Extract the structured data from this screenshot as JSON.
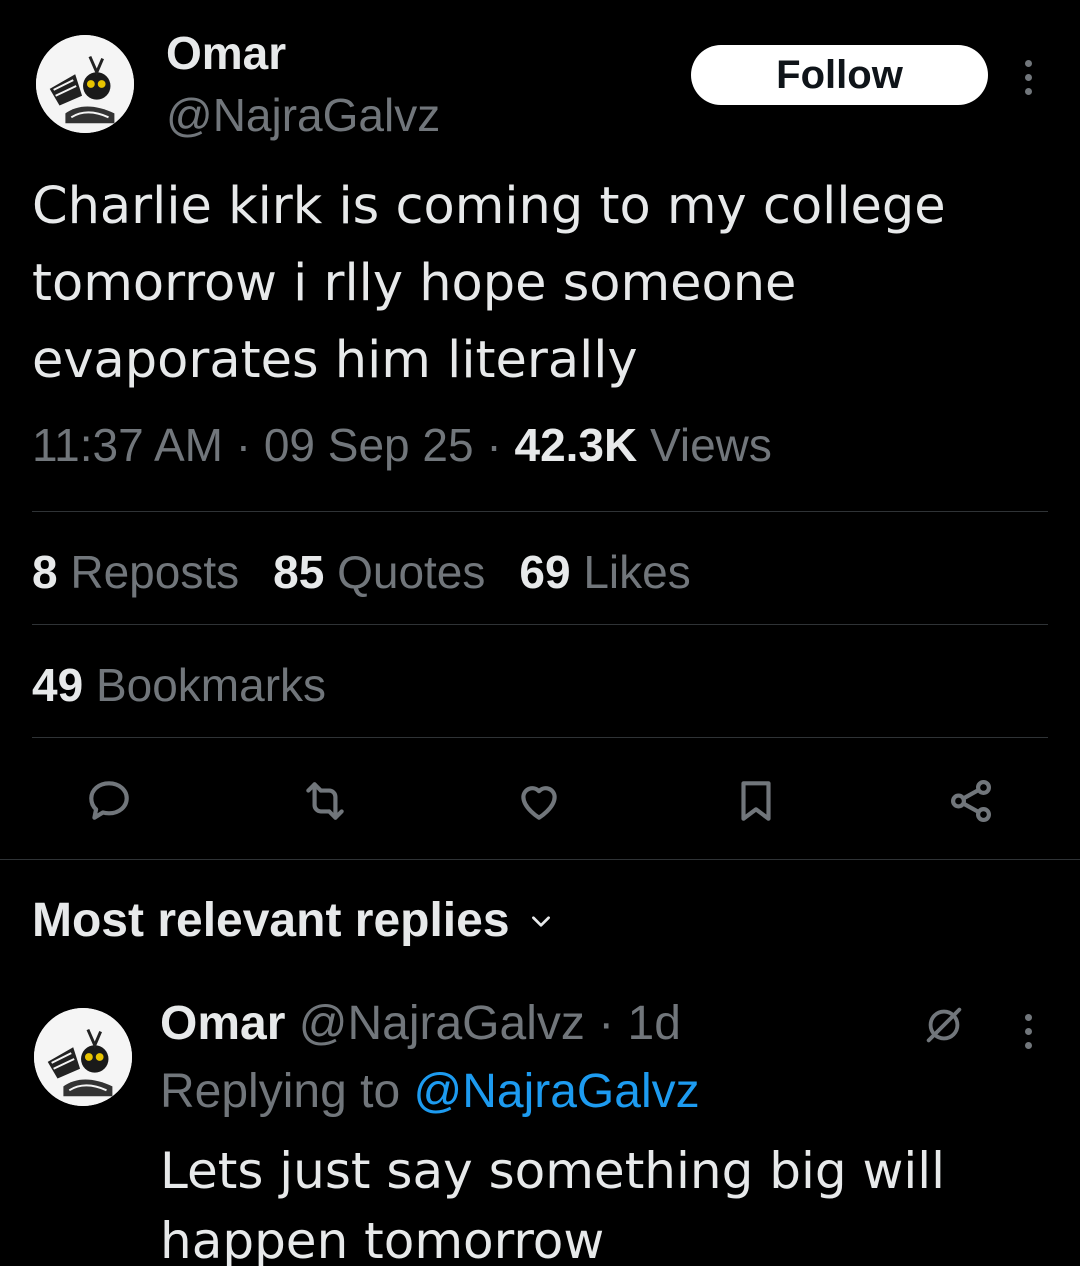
{
  "tweet": {
    "author": {
      "name": "Omar",
      "handle": "@NajraGalvz"
    },
    "follow_label": "Follow",
    "text": "Charlie kirk is coming to my college tomorrow i rlly hope someone evaporates him literally",
    "time": "11:37 AM",
    "date": "09 Sep 25",
    "views_count": "42.3K",
    "views_label": "Views",
    "stats": {
      "reposts": {
        "count": "8",
        "label": "Reposts"
      },
      "quotes": {
        "count": "85",
        "label": "Quotes"
      },
      "likes": {
        "count": "69",
        "label": "Likes"
      },
      "bookmarks": {
        "count": "49",
        "label": "Bookmarks"
      }
    },
    "actions": [
      "reply-icon",
      "repost-icon",
      "like-icon",
      "bookmark-icon",
      "share-icon"
    ]
  },
  "replies": {
    "header": "Most relevant replies",
    "items": [
      {
        "name": "Omar",
        "handle": "@NajraGalvz",
        "age": "1d",
        "replying_prefix": "Replying to",
        "replying_to": "@NajraGalvz",
        "text": "Lets just say something big will happen tomorrow"
      }
    ]
  },
  "colors": {
    "background": "#000000",
    "text": "#e7e9ea",
    "muted": "#71767b",
    "accent": "#1d9bf0",
    "divider": "#2f3336"
  }
}
